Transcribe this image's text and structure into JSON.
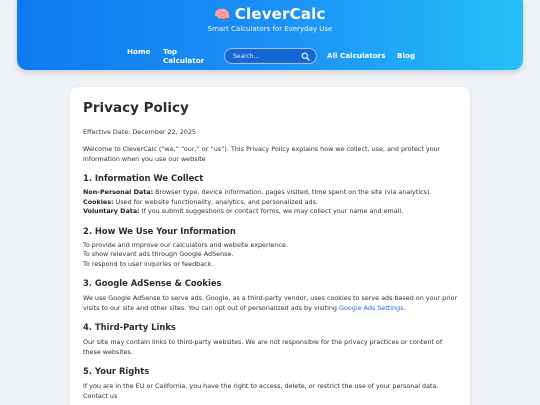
{
  "header": {
    "logo_emoji": "🧠",
    "brand": "CleverCalc",
    "tagline": "Smart Calculators for Everyday Use",
    "nav": {
      "home": "Home",
      "top_calculator": "Top Calculator",
      "all_calculators": "All Calculators",
      "blog": "Blog"
    },
    "search": {
      "placeholder": "Search...",
      "icon": "search-icon"
    }
  },
  "page": {
    "title": "Privacy Policy",
    "effective_date": "Effective Date: December 22, 2025",
    "intro": "Welcome to CleverCalc (“we,” “our,” or “us”). This Privacy Policy explains how we collect, use, and protect your information when you use our website",
    "sections": [
      {
        "heading": "1. Information We Collect",
        "items": [
          {
            "label": "Non-Personal Data:",
            "text": " Browser type, device information, pages visited, time spent on the site (via analytics)."
          },
          {
            "label": "Cookies:",
            "text": " Used for website functionality, analytics, and personalized ads."
          },
          {
            "label": "Voluntary Data:",
            "text": " If you submit suggestions or contact forms, we may collect your name and email."
          }
        ]
      },
      {
        "heading": "2. How We Use Your Information",
        "lines": [
          "To provide and improve our calculators and website experience.",
          "To show relevant ads through Google AdSense.",
          "To respond to user inquiries or feedback."
        ]
      },
      {
        "heading": "3. Google AdSense & Cookies",
        "text": "We use Google AdSense to serve ads. Google, as a third-party vendor, uses cookies to serve ads based on your prior visits to our site and other sites. You can opt out of personalized ads by visiting ",
        "link_text": "Google Ads Settings",
        "after_link": "."
      },
      {
        "heading": "4. Third-Party Links",
        "text": "Our site may contain links to third-party websites. We are not responsible for the privacy practices or content of these websites."
      },
      {
        "heading": "5. Your Rights",
        "text": "If you are in the EU or California, you have the right to access, delete, or restrict the use of your personal data. Contact us"
      }
    ]
  },
  "colors": {
    "header_start": "#0e7af0",
    "header_end": "#25c0f7",
    "link": "#1a6fd6",
    "page_bg": "#eef1f5"
  }
}
